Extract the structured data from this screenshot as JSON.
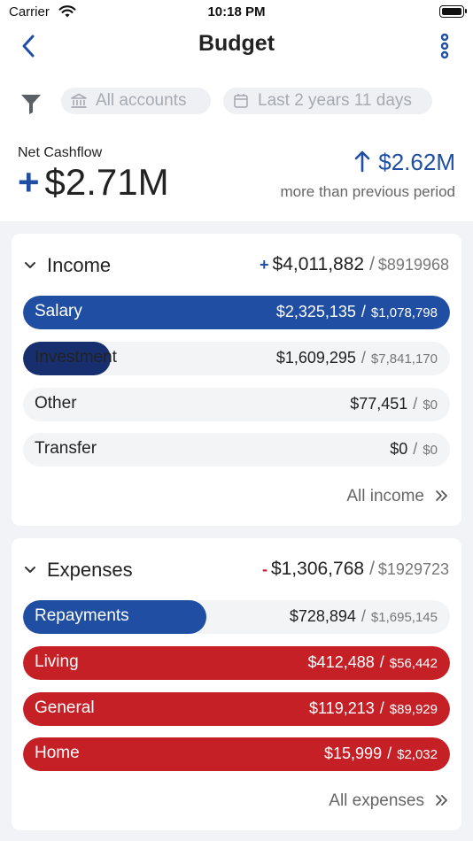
{
  "status_bar": {
    "carrier": "Carrier",
    "time": "10:18 PM"
  },
  "header": {
    "title": "Budget"
  },
  "filters": {
    "accounts": "All accounts",
    "period": "Last 2 years 11 days"
  },
  "net_cashflow": {
    "label": "Net Cashflow",
    "sign": "+",
    "value": "$2.71M",
    "change": "$2.62M",
    "change_note": "more than previous period"
  },
  "income": {
    "title": "Income",
    "sign": "+",
    "total": "$4,011,882",
    "budget": "$8919968",
    "items": [
      {
        "label": "Salary",
        "amount": "$2,325,135",
        "budget": "$1,078,798",
        "progress": 1.0
      },
      {
        "label": "Investment",
        "amount": "$1,609,295",
        "budget": "$7,841,170",
        "progress": 0.205
      },
      {
        "label": "Other",
        "amount": "$77,451",
        "budget": "$0",
        "progress": 0
      },
      {
        "label": "Transfer",
        "amount": "$0",
        "budget": "$0",
        "progress": 0
      }
    ],
    "link": "All income"
  },
  "expenses": {
    "title": "Expenses",
    "sign": "-",
    "total": "$1,306,768",
    "budget": "$1929723",
    "items": [
      {
        "label": "Repayments",
        "amount": "$728,894",
        "budget": "$1,695,145",
        "progress": 0.43
      },
      {
        "label": "Living",
        "amount": "$412,488",
        "budget": "$56,442",
        "progress": 1.0
      },
      {
        "label": "General",
        "amount": "$119,213",
        "budget": "$89,929",
        "progress": 1.0
      },
      {
        "label": "Home",
        "amount": "$15,999",
        "budget": "$2,032",
        "progress": 1.0
      }
    ],
    "link": "All expenses"
  },
  "colors": {
    "primary_blue": "#1f4ea3",
    "dark_navy": "#172f6e",
    "expense_red": "#c62027",
    "track": "#f3f4f6"
  },
  "icons": [
    "wifi-icon",
    "battery-icon",
    "back-chevron-icon",
    "more-vertical-icon",
    "filter-icon",
    "bank-icon",
    "calendar-icon",
    "arrow-up-icon",
    "chevron-down-icon",
    "double-chevron-right-icon"
  ]
}
